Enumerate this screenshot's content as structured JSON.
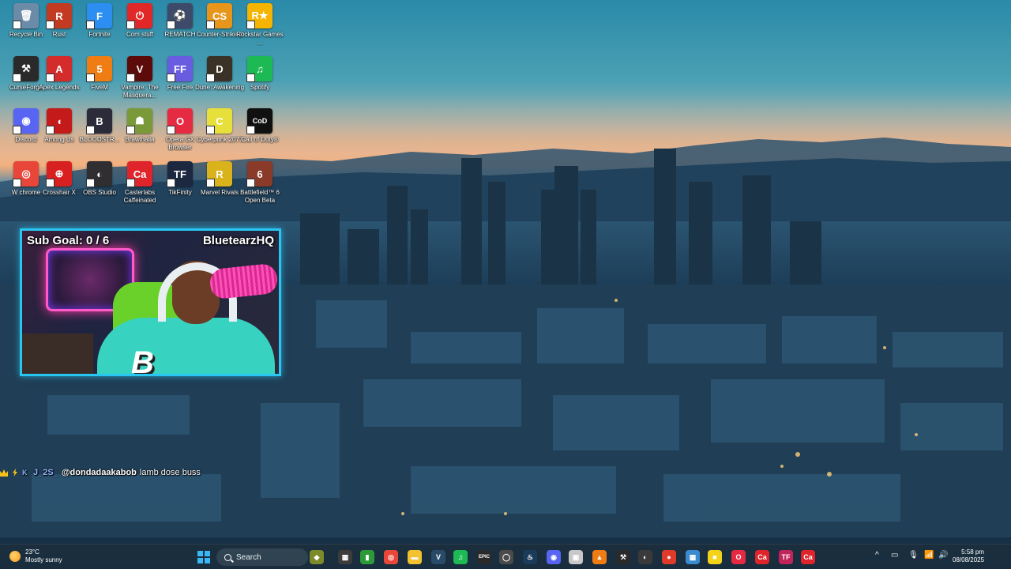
{
  "desktop": {
    "icons": [
      {
        "label": "Recycle Bin",
        "glyph": "🗑",
        "color": "#6c8ba8",
        "icon": "recycle-bin-icon"
      },
      {
        "label": "Rust",
        "glyph": "R",
        "color": "#c23a22",
        "icon": "rust-icon"
      },
      {
        "label": "Fortnite",
        "glyph": "F",
        "color": "#2b8ef0",
        "icon": "fortnite-icon"
      },
      {
        "label": "Com stuff",
        "glyph": "⏻",
        "color": "#e02828",
        "icon": "power-icon"
      },
      {
        "label": "REMATCH",
        "glyph": "⚽",
        "color": "#3e4a6a",
        "icon": "rematch-icon"
      },
      {
        "label": "Counter-Strike 2",
        "glyph": "CS",
        "color": "#e8951c",
        "icon": "counter-strike-icon"
      },
      {
        "label": "Rockstar Games ...",
        "glyph": "R★",
        "color": "#f5b400",
        "icon": "rockstar-icon"
      },
      {
        "label": "CurseForge",
        "glyph": "⚒",
        "color": "#2a2a2a",
        "icon": "curseforge-icon"
      },
      {
        "label": "Apex Legends",
        "glyph": "A",
        "color": "#d42b2b",
        "icon": "apex-icon"
      },
      {
        "label": "FiveM",
        "glyph": "5",
        "color": "#f07d14",
        "icon": "fivem-icon"
      },
      {
        "label": "Vampire: The Masquera...",
        "glyph": "V",
        "color": "#5c0a0a",
        "icon": "vampire-icon"
      },
      {
        "label": "Free Fire",
        "glyph": "FF",
        "color": "#6a5ce0",
        "icon": "free-fire-icon"
      },
      {
        "label": "Dune: Awakening",
        "glyph": "D",
        "color": "#3a3226",
        "icon": "dune-icon"
      },
      {
        "label": "Spotify",
        "glyph": "♫",
        "color": "#1db954",
        "icon": "spotify-icon"
      },
      {
        "label": "Discord",
        "glyph": "◉",
        "color": "#5865f2",
        "icon": "discord-icon"
      },
      {
        "label": "Among Us",
        "glyph": "◖",
        "color": "#c41a1a",
        "icon": "among-us-icon"
      },
      {
        "label": "BLOODSTR...",
        "glyph": "B",
        "color": "#2b2b3a",
        "icon": "bloodstrike-icon"
      },
      {
        "label": "Brawlhalla",
        "glyph": "☗",
        "color": "#7a9a3a",
        "icon": "brawlhalla-icon"
      },
      {
        "label": "Opera GX Browser",
        "glyph": "O",
        "color": "#e62a42",
        "icon": "opera-gx-icon"
      },
      {
        "label": "Cyberpunk 2077",
        "glyph": "C",
        "color": "#e8e03a",
        "icon": "cyberpunk-icon"
      },
      {
        "label": "Call of Duty®",
        "glyph": "CoD",
        "color": "#101010",
        "icon": "call-of-duty-icon"
      },
      {
        "label": "W chrome",
        "glyph": "◎",
        "color": "#e9463a",
        "icon": "chrome-icon"
      },
      {
        "label": "Crosshair X",
        "glyph": "⊕",
        "color": "#d82020",
        "icon": "crosshair-icon"
      },
      {
        "label": "OBS Studio",
        "glyph": "◐",
        "color": "#302e31",
        "icon": "obs-icon"
      },
      {
        "label": "Casterlabs Caffeinated",
        "glyph": "Ca",
        "color": "#e0242c",
        "icon": "casterlabs-icon"
      },
      {
        "label": "TikFinity",
        "glyph": "TF",
        "color": "#1c2740",
        "icon": "tikfinity-icon"
      },
      {
        "label": "Marvel Rivals",
        "glyph": "R",
        "color": "#d9b21c",
        "icon": "marvel-rivals-icon"
      },
      {
        "label": "Battlefield™ 6 Open Beta",
        "glyph": "6",
        "color": "#8a3a28",
        "icon": "battlefield-icon"
      }
    ]
  },
  "stream": {
    "sub_goal": "Sub Goal:  0 / 6",
    "channel": "BluetearzHQ",
    "cam_logo": "B"
  },
  "chat": {
    "username": "J_2S_",
    "mention": "@dondadaakabob",
    "message": "lamb dose buss"
  },
  "taskbar": {
    "weather_temp": "23°C",
    "weather_desc": "Mostly sunny",
    "search_placeholder": "Search",
    "time": "5:58 pm",
    "date": "08/08/2025",
    "apps": [
      {
        "glyph": "◆",
        "color": "#7c8a2a",
        "icon": "game-app-icon"
      },
      {
        "glyph": "▦",
        "color": "#3c3c3c",
        "icon": "task-view-icon"
      },
      {
        "glyph": "▮",
        "color": "#2d9a3a",
        "icon": "xbox-bar-icon"
      },
      {
        "glyph": "◎",
        "color": "#e9463a",
        "icon": "chrome-taskbar-icon"
      },
      {
        "glyph": "▬",
        "color": "#f2c230",
        "icon": "file-explorer-icon"
      },
      {
        "glyph": "V",
        "color": "#2a4a6a",
        "icon": "vs-code-icon"
      },
      {
        "glyph": "♫",
        "color": "#1db954",
        "icon": "spotify-taskbar-icon"
      },
      {
        "glyph": "EPIC",
        "color": "#2a2a2a",
        "icon": "epic-games-icon"
      },
      {
        "glyph": "◯",
        "color": "#4a4a4a",
        "icon": "circle-app-icon"
      },
      {
        "glyph": "♨",
        "color": "#1b3b5a",
        "icon": "steam-icon"
      },
      {
        "glyph": "◉",
        "color": "#5865f2",
        "icon": "discord-taskbar-icon"
      },
      {
        "glyph": "▣",
        "color": "#c8c8c8",
        "icon": "capture-icon"
      },
      {
        "glyph": "▲",
        "color": "#f07d14",
        "icon": "vlc-icon"
      },
      {
        "glyph": "⚒",
        "color": "#2a2a2a",
        "icon": "curseforge-taskbar-icon"
      },
      {
        "glyph": "◐",
        "color": "#3a3a3a",
        "icon": "obs-taskbar-icon"
      },
      {
        "glyph": "●",
        "color": "#e03a2a",
        "icon": "recording-app-icon"
      },
      {
        "glyph": "▦",
        "color": "#3a8ad0",
        "icon": "photos-icon"
      },
      {
        "glyph": "■",
        "color": "#f5d21a",
        "icon": "sticky-notes-icon"
      },
      {
        "glyph": "O",
        "color": "#e62a42",
        "icon": "opera-gx-taskbar-icon"
      },
      {
        "glyph": "Ca",
        "color": "#e0242c",
        "icon": "casterlabs-taskbar-icon"
      },
      {
        "glyph": "TF",
        "color": "#c0245a",
        "icon": "tikfinity-taskbar-icon"
      },
      {
        "glyph": "Ca",
        "color": "#e0242c",
        "icon": "casterlabs-taskbar-icon-2"
      }
    ],
    "tray": [
      "^",
      "▭",
      "🎙",
      "📶",
      "🔊"
    ]
  }
}
